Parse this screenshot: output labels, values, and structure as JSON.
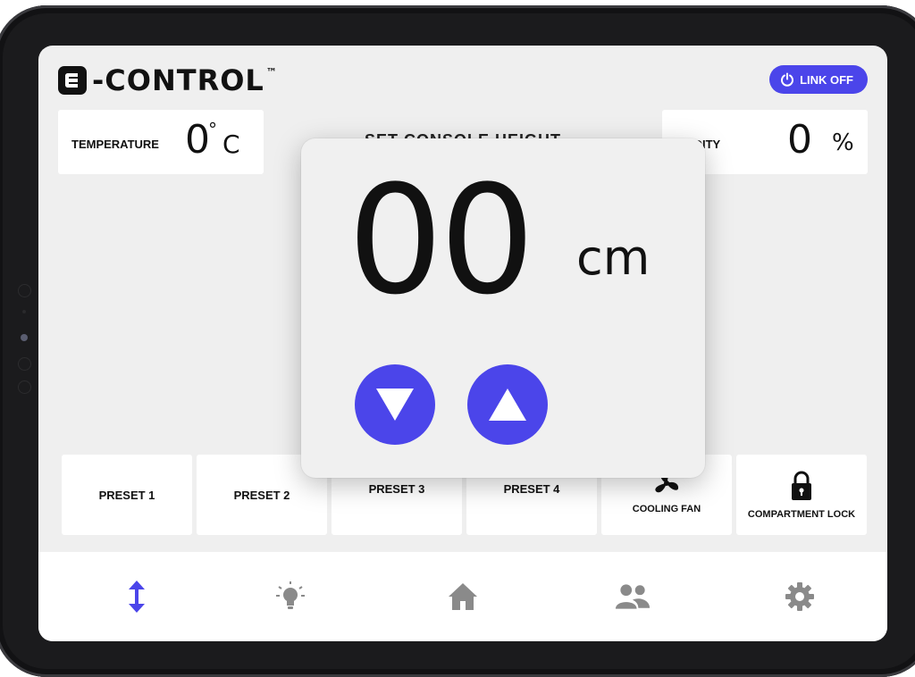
{
  "header": {
    "logo_text": "-CONTROL",
    "logo_tm": "™",
    "link_button_label": "LINK OFF"
  },
  "temperature": {
    "label": "TEMPERATURE",
    "value": "0",
    "degree": "°",
    "unit": "C"
  },
  "humidity": {
    "label": "IDITY",
    "value": "0",
    "unit": "%"
  },
  "console_title": "SET CONSOLE HEIGHT",
  "height_popup": {
    "value": "00",
    "unit": "cm"
  },
  "tiles": {
    "preset1": "PRESET 1",
    "preset2": "PRESET 2",
    "preset3": "PRESET 3",
    "preset4": "PRESET 4",
    "cooling_fan": "COOLING FAN",
    "compartment_lock": "COMPARTMENT LOCK"
  },
  "colors": {
    "accent": "#4b45ea",
    "nav_inactive": "#8a8a8a",
    "screen_bg": "#efefef"
  },
  "nav_icons": [
    "height-icon",
    "light-bulb-icon",
    "home-icon",
    "users-icon",
    "gear-icon"
  ]
}
